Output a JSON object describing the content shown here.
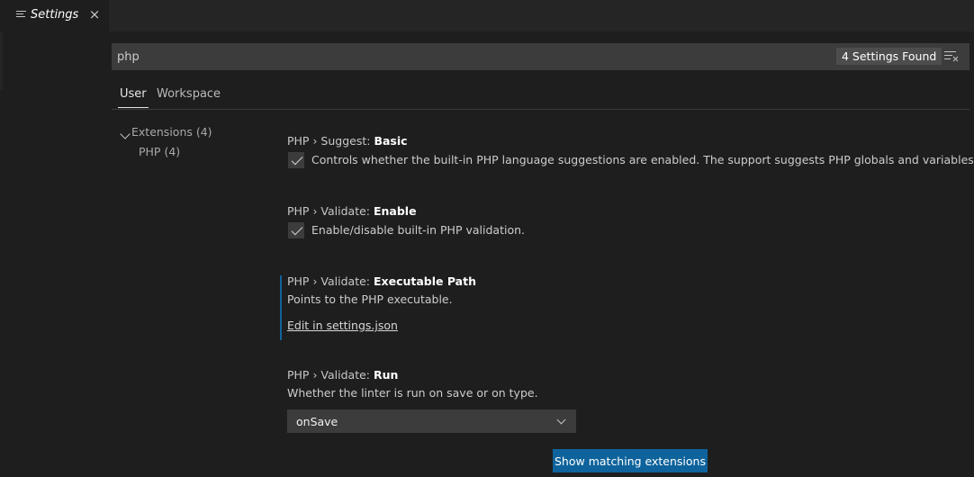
{
  "tab": {
    "title": "Settings",
    "close_glyph": "×",
    "icon": "settings-doc-icon"
  },
  "search": {
    "value": "php",
    "placeholder": "",
    "count_badge": "4 Settings Found",
    "clear_icon": "clear-filter-icon"
  },
  "scopes": [
    {
      "label": "User",
      "active": true
    },
    {
      "label": "Workspace",
      "active": false
    }
  ],
  "toc": {
    "group_label": "Extensions (4)",
    "child_label": "PHP (4)"
  },
  "settings": [
    {
      "category": "PHP › Suggest: ",
      "key": "Basic",
      "description": "Controls whether the built-in PHP language suggestions are enabled. The support suggests PHP globals and variables.",
      "control": "checkbox",
      "checked": true
    },
    {
      "category": "PHP › Validate: ",
      "key": "Enable",
      "description": "Enable/disable built-in PHP validation.",
      "control": "checkbox",
      "checked": true
    },
    {
      "category": "PHP › Validate: ",
      "key": "Executable Path",
      "description": "Points to the PHP executable.",
      "control": "link",
      "link_label": "Edit in settings.json"
    },
    {
      "category": "PHP › Validate: ",
      "key": "Run",
      "description": "Whether the linter is run on save or on type.",
      "control": "select",
      "selected": "onSave"
    }
  ],
  "footer": {
    "button_label": "Show matching extensions"
  },
  "colors": {
    "accent": "#0e639c",
    "background": "#1e1e1e",
    "input_bg": "#3c3c3c"
  }
}
